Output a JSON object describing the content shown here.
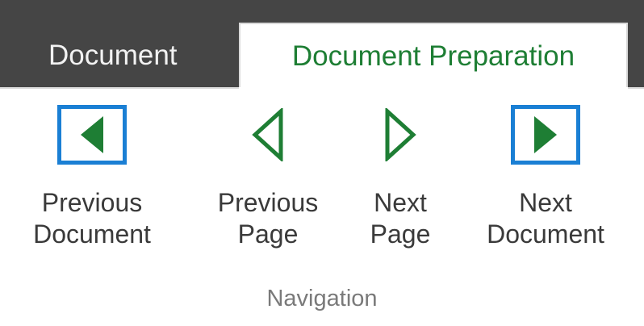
{
  "tabs": {
    "document": "Document",
    "document_preparation": "Document Preparation"
  },
  "navigation": {
    "group_label": "Navigation",
    "previous_document": {
      "line1": "Previous",
      "line2": "Document",
      "icon": "triangle-left-filled-icon"
    },
    "previous_page": {
      "line1": "Previous",
      "line2": "Page",
      "icon": "triangle-left-outline-icon"
    },
    "next_page": {
      "line1": "Next",
      "line2": "Page",
      "icon": "triangle-right-outline-icon"
    },
    "next_document": {
      "line1": "Next",
      "line2": "Document",
      "icon": "triangle-right-filled-icon"
    }
  },
  "colors": {
    "accent_green": "#1e7e34",
    "icon_frame_blue": "#1a7fd4",
    "tab_strip_dark": "#454545"
  }
}
